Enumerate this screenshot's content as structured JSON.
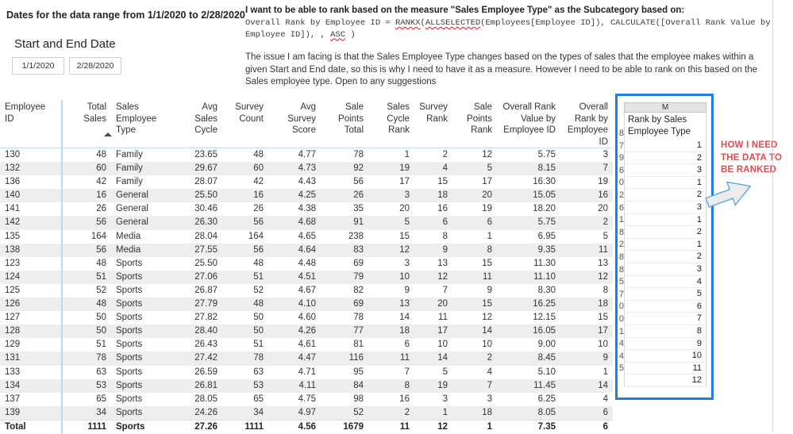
{
  "report": {
    "range_title": "Dates for the data range from 1/1/2020 to 2/28/2020",
    "slicer_title": "Start and End Date",
    "date_start": "1/1/2020",
    "date_end": "2/28/2020"
  },
  "notes": {
    "headline": "I want to be able to rank based on the measure \"Sales Employee Type\" as the Subcategory  based on:",
    "code_pre": "Overall Rank by Employee ID = ",
    "code_fn1": "RANKX",
    "code_mid1": "(",
    "code_fn2": "ALLSELECTED",
    "code_mid2": "(Employees[Employee ID]), CALCULATE([Overall Rank Value by Employee ID]), , ",
    "code_fn3": "ASC",
    "code_post": " )",
    "body": "The issue I am facing is that the Sales Employee Type changes based on the types of sales that the employee makes within a given Start and End date, so this is why I need to have it as a measure. However I need to be able to rank on this based on the Sales employee type. Open to any suggestions"
  },
  "matrix": {
    "columns": [
      "Employee ID",
      "Total Sales",
      "Sales Employee Type",
      "Avg Sales Cycle",
      "Survey Count",
      "Avg Survey Score",
      "Sale Points Total",
      "Sales Cycle Rank",
      "Survey Rank",
      "Sale Points Rank",
      "Overall Rank Value by Employee ID",
      "Overall Rank by Employee ID"
    ],
    "rows": [
      [
        "130",
        "48",
        "Family",
        "23.65",
        "48",
        "4.77",
        "78",
        "1",
        "2",
        "12",
        "5.75",
        "3"
      ],
      [
        "132",
        "60",
        "Family",
        "29.67",
        "60",
        "4.73",
        "92",
        "19",
        "4",
        "5",
        "8.15",
        "7"
      ],
      [
        "136",
        "42",
        "Family",
        "28.07",
        "42",
        "4.43",
        "56",
        "17",
        "15",
        "17",
        "16.30",
        "19"
      ],
      [
        "140",
        "16",
        "General",
        "25.50",
        "16",
        "4.25",
        "26",
        "3",
        "18",
        "20",
        "15.05",
        "16"
      ],
      [
        "141",
        "26",
        "General",
        "30.46",
        "26",
        "4.38",
        "35",
        "20",
        "16",
        "19",
        "18.20",
        "20"
      ],
      [
        "142",
        "56",
        "General",
        "26.30",
        "56",
        "4.68",
        "91",
        "5",
        "6",
        "6",
        "5.75",
        "2"
      ],
      [
        "135",
        "164",
        "Media",
        "28.04",
        "164",
        "4.65",
        "238",
        "15",
        "8",
        "1",
        "6.95",
        "5"
      ],
      [
        "138",
        "56",
        "Media",
        "27.55",
        "56",
        "4.64",
        "83",
        "12",
        "9",
        "8",
        "9.35",
        "11"
      ],
      [
        "123",
        "48",
        "Sports",
        "25.50",
        "48",
        "4.48",
        "69",
        "3",
        "13",
        "15",
        "11.30",
        "13"
      ],
      [
        "124",
        "51",
        "Sports",
        "27.06",
        "51",
        "4.51",
        "79",
        "10",
        "12",
        "11",
        "11.10",
        "12"
      ],
      [
        "125",
        "52",
        "Sports",
        "26.87",
        "52",
        "4.67",
        "82",
        "9",
        "7",
        "9",
        "8.30",
        "8"
      ],
      [
        "126",
        "48",
        "Sports",
        "27.79",
        "48",
        "4.10",
        "69",
        "13",
        "20",
        "15",
        "16.25",
        "18"
      ],
      [
        "127",
        "50",
        "Sports",
        "27.82",
        "50",
        "4.60",
        "78",
        "14",
        "11",
        "12",
        "12.15",
        "15"
      ],
      [
        "128",
        "50",
        "Sports",
        "28.40",
        "50",
        "4.26",
        "77",
        "18",
        "17",
        "14",
        "16.05",
        "17"
      ],
      [
        "129",
        "51",
        "Sports",
        "26.43",
        "51",
        "4.61",
        "81",
        "6",
        "10",
        "10",
        "9.00",
        "10"
      ],
      [
        "131",
        "78",
        "Sports",
        "27.42",
        "78",
        "4.47",
        "116",
        "11",
        "14",
        "2",
        "8.45",
        "9"
      ],
      [
        "133",
        "63",
        "Sports",
        "26.59",
        "63",
        "4.71",
        "95",
        "7",
        "5",
        "4",
        "5.10",
        "1"
      ],
      [
        "134",
        "53",
        "Sports",
        "26.81",
        "53",
        "4.11",
        "84",
        "8",
        "19",
        "7",
        "11.45",
        "14"
      ],
      [
        "137",
        "65",
        "Sports",
        "28.05",
        "65",
        "4.75",
        "98",
        "16",
        "3",
        "3",
        "6.25",
        "4"
      ],
      [
        "139",
        "34",
        "Sports",
        "24.26",
        "34",
        "4.97",
        "52",
        "2",
        "1",
        "18",
        "8.05",
        "6"
      ]
    ],
    "total_row": [
      "Total",
      "1111",
      "Sports",
      "27.26",
      "1111",
      "4.56",
      "1679",
      "11",
      "12",
      "1",
      "7.35",
      "6"
    ]
  },
  "callout": {
    "sheet_column_letter": "M",
    "sheet_title": "Rank by Sales Employee Type",
    "values": [
      "1",
      "2",
      "3",
      "1",
      "2",
      "3",
      "1",
      "2",
      "1",
      "2",
      "3",
      "4",
      "5",
      "6",
      "7",
      "8",
      "9",
      "10",
      "11",
      "12"
    ],
    "clipped_digits": [
      "8",
      "7",
      "9",
      "6",
      "0",
      "2",
      "6",
      "1",
      "8",
      "2",
      "8",
      "8",
      "5",
      "7",
      "0",
      "0",
      "1",
      "4",
      "4",
      "5"
    ],
    "annotation": "HOW I NEED THE DATA TO BE RANKED"
  },
  "colors": {
    "callout_border": "#1f7fe0",
    "annotation_red": "#e04b50",
    "divider_blue": "#bcd9f2",
    "alt_row": "#eeeeee"
  }
}
